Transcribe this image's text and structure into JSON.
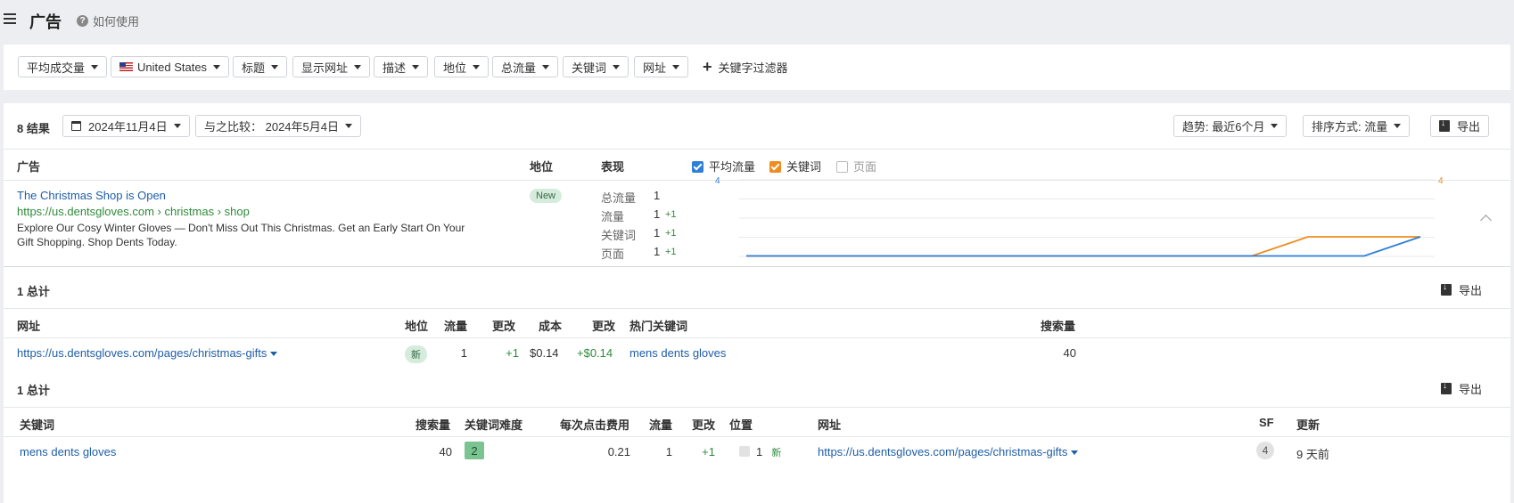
{
  "header": {
    "title": "广告",
    "help": "如何使用"
  },
  "filters": [
    {
      "label": "平均成交量"
    },
    {
      "label": "United States",
      "flag": "us"
    },
    {
      "label": "标题"
    },
    {
      "label": "显示网址"
    },
    {
      "label": "描述"
    },
    {
      "label": "地位"
    },
    {
      "label": "总流量"
    },
    {
      "label": "关键词"
    },
    {
      "label": "网址"
    }
  ],
  "keyword_filter": "关键字过滤器",
  "results": {
    "count": "8 结果",
    "date": "2024年11月4日",
    "compare": "与之比较：  2024年5月4日",
    "trend": "趋势: 最近6个月",
    "sort": "排序方式: 流量",
    "export": "导出"
  },
  "ads_table": {
    "headers": {
      "ad": "广告",
      "position": "地位",
      "performance": "表现"
    },
    "legend": [
      {
        "label": "平均流量",
        "checked": true,
        "color": "#2f7ed8"
      },
      {
        "label": "关键词",
        "checked": true,
        "color": "#ef8c1f"
      },
      {
        "label": "页面",
        "checked": false
      }
    ],
    "row": {
      "title": "The Christmas Shop is Open",
      "url": "https://us.dentsgloves.com › christmas › shop",
      "desc_line1": "Explore Our Cosy Winter Gloves — Don't Miss Out This Christmas. Get an Early Start On Your",
      "desc_line2": "Gift Shopping. Shop Dents Today.",
      "badge": "New",
      "metrics": [
        {
          "label": "总流量",
          "value": "1",
          "delta": ""
        },
        {
          "label": "流量",
          "value": "1",
          "delta": "+1"
        },
        {
          "label": "关键词",
          "value": "1",
          "delta": "+1"
        },
        {
          "label": "页面",
          "value": "1",
          "delta": "+1"
        }
      ]
    }
  },
  "chart_data": {
    "type": "line",
    "y_left_max": "4",
    "y_right_max": "4",
    "series": [
      {
        "name": "平均流量",
        "color": "#2f7ed8",
        "values": [
          0,
          0,
          0,
          0,
          0,
          0,
          0,
          0,
          0,
          0,
          0,
          0,
          1
        ]
      },
      {
        "name": "关键词",
        "color": "#ef8c1f",
        "values": [
          0,
          0,
          0,
          0,
          0,
          0,
          0,
          0,
          0,
          0,
          1,
          1,
          1
        ]
      }
    ]
  },
  "urls_section": {
    "total": "1 总计",
    "export": "导出",
    "headers": [
      "网址",
      "地位",
      "流量",
      "更改",
      "成本",
      "更改",
      "热门关键词",
      "搜索量"
    ],
    "row": {
      "url": "https://us.dentsgloves.com/pages/christmas-gifts",
      "status": "新",
      "traffic": "1",
      "change": "+1",
      "cost": "$0.14",
      "cost_change": "+$0.14",
      "keyword": "mens dents gloves",
      "volume": "40"
    }
  },
  "keywords_section": {
    "total": "1 总计",
    "export": "导出",
    "headers": [
      "关键词",
      "搜索量",
      "关键词难度",
      "每次点击费用",
      "流量",
      "更改",
      "位置",
      "网址",
      "SF",
      "更新"
    ],
    "row": {
      "keyword": "mens dents gloves",
      "volume": "40",
      "kd": "2",
      "cpc": "0.21",
      "traffic": "1",
      "change": "+1",
      "position": "1",
      "position_tag": "新",
      "url": "https://us.dentsgloves.com/pages/christmas-gifts",
      "sf": "4",
      "updated": "9 天前"
    }
  }
}
